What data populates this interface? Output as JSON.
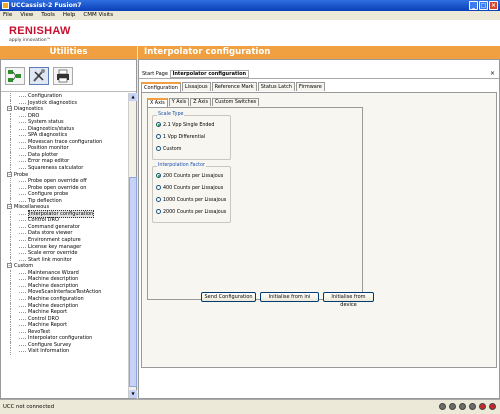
{
  "window": {
    "title": "UCCassist-2 Fusion7",
    "min": "_",
    "max": "□",
    "close": "×"
  },
  "menu": [
    "File",
    "View",
    "Tools",
    "Help",
    "CMM Visits"
  ],
  "brand": {
    "logo": "RENISHAW",
    "tagline": "apply innovation™"
  },
  "left_header": "Utilities",
  "right_header": "Interpolator configuration",
  "tree": [
    {
      "type": "item",
      "label": "Configuration"
    },
    {
      "type": "item",
      "label": "Joystick diagnostics"
    },
    {
      "type": "cat",
      "label": "Diagnostics"
    },
    {
      "type": "item",
      "label": "DRO"
    },
    {
      "type": "item",
      "label": "System status"
    },
    {
      "type": "item",
      "label": "Diagnostics/status"
    },
    {
      "type": "item",
      "label": "SPA diagnostics"
    },
    {
      "type": "item",
      "label": "Movescan trace configuration"
    },
    {
      "type": "item",
      "label": "Position monitor"
    },
    {
      "type": "item",
      "label": "Data plotter"
    },
    {
      "type": "item",
      "label": "Error map editor"
    },
    {
      "type": "item",
      "label": "Squareness calculator"
    },
    {
      "type": "cat",
      "label": "Probe"
    },
    {
      "type": "item",
      "label": "Probe open override off"
    },
    {
      "type": "item",
      "label": "Probe open override on"
    },
    {
      "type": "item",
      "label": "Configure probe"
    },
    {
      "type": "item",
      "label": "Tip deflection"
    },
    {
      "type": "cat",
      "label": "Miscellaneous"
    },
    {
      "type": "item",
      "label": "Interpolator configuration",
      "selected": true
    },
    {
      "type": "item",
      "label": "Control DRO"
    },
    {
      "type": "item",
      "label": "Command generator"
    },
    {
      "type": "item",
      "label": "Data store viewer"
    },
    {
      "type": "item",
      "label": "Environment capture"
    },
    {
      "type": "item",
      "label": "License key manager"
    },
    {
      "type": "item",
      "label": "Scale error override"
    },
    {
      "type": "item",
      "label": "Start link monitor"
    },
    {
      "type": "cat",
      "label": "Custom"
    },
    {
      "type": "item",
      "label": "Maintenance Wizard"
    },
    {
      "type": "item",
      "label": "Machine description"
    },
    {
      "type": "item",
      "label": "Machine description"
    },
    {
      "type": "item",
      "label": "MoveScanInterfaceTestAction"
    },
    {
      "type": "item",
      "label": "Machine configuration"
    },
    {
      "type": "item",
      "label": "Machine description"
    },
    {
      "type": "item",
      "label": "Machine Report"
    },
    {
      "type": "item",
      "label": "Control DRO"
    },
    {
      "type": "item",
      "label": "Machine Report"
    },
    {
      "type": "item",
      "label": "RevoTest"
    },
    {
      "type": "item",
      "label": "Interpolator configuration"
    },
    {
      "type": "item",
      "label": "Configure Survey"
    },
    {
      "type": "item",
      "label": "Visit Information"
    }
  ],
  "breadcrumb": {
    "prefix": "Start Page",
    "current": "Interpolator configuration",
    "close": "×"
  },
  "tabs": [
    "Configuration",
    "Lissajous",
    "Reference Mark",
    "Status Latch",
    "Firmware"
  ],
  "subtabs": [
    "X Axis",
    "Y Axis",
    "Z Axis",
    "Custom Switches"
  ],
  "scale_type": {
    "title": "Scale Type",
    "options": [
      "2.1 Vpp Single Ended",
      "1 Vpp Differential",
      "Custom"
    ],
    "selected": 0
  },
  "interpolation": {
    "title": "Interpolation Factor",
    "options": [
      "200 Counts per Lissajous",
      "400 Counts per Lissajous",
      "1000 Counts per Lissajous",
      "2000 Counts per Lissajous"
    ],
    "selected": 0
  },
  "buttons": {
    "send": "Send Configuration",
    "init_ini": "Initialise from ini",
    "init_device": "Initialise from device"
  },
  "status": "UCC not connected"
}
